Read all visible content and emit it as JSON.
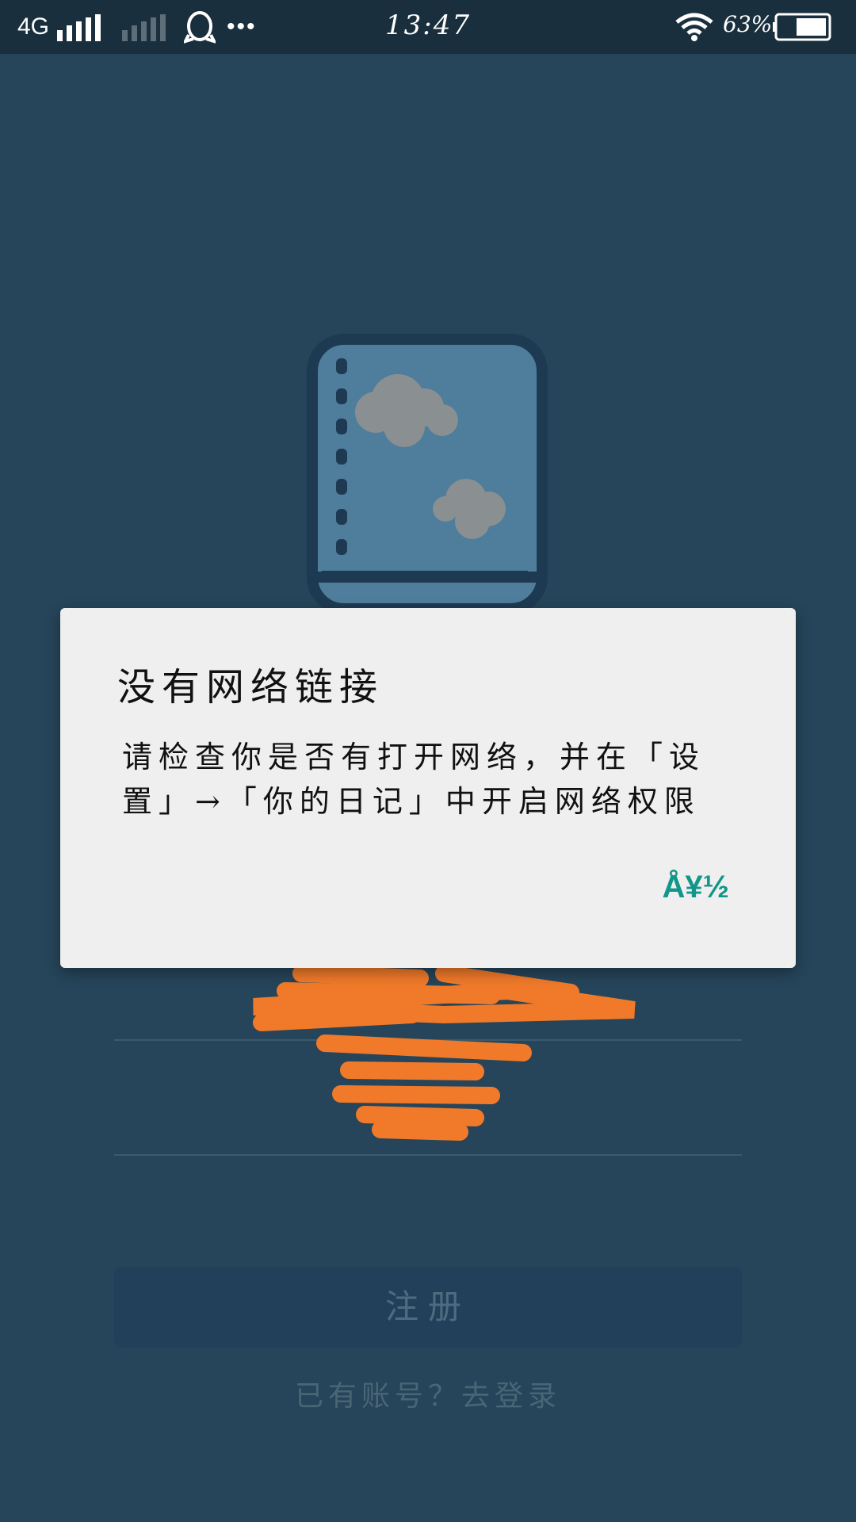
{
  "status_bar": {
    "network": "4G",
    "time": "13:47",
    "battery_percent": "63%",
    "more": "•••",
    "icons": [
      "signal-icon",
      "signal-sim2-icon",
      "qq-icon",
      "wifi-icon",
      "battery-icon"
    ]
  },
  "app": {
    "register_label": "注册",
    "login_link": "已有账号？去登录"
  },
  "dialog": {
    "title": "没有网络链接",
    "message": "请检查你是否有打开网络，并在「设置」→「你的日记」中开启网络权限",
    "ok_label": "Å¥½"
  },
  "colors": {
    "background": "#26455a",
    "status_bar": "#1a2f3d",
    "dialog_bg": "#efefef",
    "accent": "#13968a",
    "redaction": "#f07a2a"
  }
}
